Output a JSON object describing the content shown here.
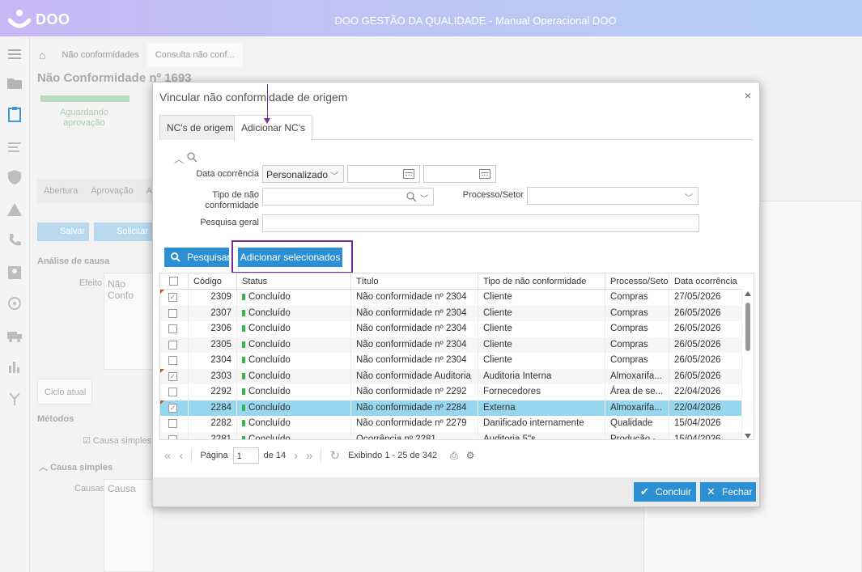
{
  "app": {
    "logo_text": "DOO",
    "window_title": "DOO GESTÃO DA QUALIDADE - Manual Operacional DOO"
  },
  "background": {
    "breadcrumbs": [
      "Não conformidades",
      "Consulta não conf..."
    ],
    "page_title": "Não Conformidade nº 1693",
    "status_line1": "Aguardando",
    "status_line2": "aprovação",
    "subtabs": [
      "Abertura",
      "Aprovação",
      "A"
    ],
    "btn_save": "Salvar",
    "btn_request": "Solicitar",
    "section_cause": "Análise de causa",
    "label_effect": "Efeito",
    "effect_value": "Não Confo",
    "current_cycle": "Ciclo atual",
    "methods": "Métodos",
    "simple_cause_check": "Causa simples",
    "simple_cause_header": "Causa simples",
    "label_causes": "Causas",
    "causes_value": "Causa"
  },
  "modal": {
    "title": "Vincular não conformidade de origem",
    "close_icon": "×",
    "tabs": [
      "NC's de origem",
      "Adicionar NC's"
    ],
    "filters": {
      "date_label": "Data ocorrência",
      "date_mode": "Personalizado",
      "date_from": "",
      "date_to": "",
      "type_label_1": "Tipo de não",
      "type_label_2": "conformidade",
      "type_value": "",
      "process_label": "Processo/Setor",
      "process_value": "",
      "general_label": "Pesquisa geral",
      "general_value": ""
    },
    "btn_search": "Pesquisar",
    "btn_add_selected": "Adicionar selecionados",
    "columns": [
      "Código",
      "Status",
      "Título",
      "Tipo de não conformidade",
      "Processo/Setor",
      "Data ocorrência"
    ],
    "rows": [
      {
        "checked": true,
        "flag": true,
        "code": "2309",
        "status": "Concluído",
        "title": "Não conformidade nº 2304",
        "type": "Cliente",
        "process": "Compras",
        "date": "27/05/2026"
      },
      {
        "checked": false,
        "flag": false,
        "code": "2307",
        "status": "Concluído",
        "title": "Não conformidade nº 2304",
        "type": "Cliente",
        "process": "Compras",
        "date": "26/05/2026"
      },
      {
        "checked": false,
        "flag": false,
        "code": "2306",
        "status": "Concluído",
        "title": "Não conformidade nº 2304",
        "type": "Cliente",
        "process": "Compras",
        "date": "26/05/2026"
      },
      {
        "checked": false,
        "flag": false,
        "code": "2305",
        "status": "Concluído",
        "title": "Não conformidade nº 2304",
        "type": "Cliente",
        "process": "Compras",
        "date": "26/05/2026"
      },
      {
        "checked": false,
        "flag": false,
        "code": "2304",
        "status": "Concluído",
        "title": "Não conformidade nº 2304",
        "type": "Cliente",
        "process": "Compras",
        "date": "26/05/2026"
      },
      {
        "checked": true,
        "flag": true,
        "code": "2303",
        "status": "Concluído",
        "title": "Não conformidade Auditoria",
        "type": "Auditoria Interna",
        "process": "Almoxarifa...",
        "date": "26/05/2026"
      },
      {
        "checked": false,
        "flag": false,
        "code": "2292",
        "status": "Concluído",
        "title": "Não conformidade nº 2292",
        "type": "Fornecedores",
        "process": "Área de se...",
        "date": "22/04/2026"
      },
      {
        "checked": true,
        "flag": true,
        "code": "2284",
        "status": "Concluído",
        "title": "Não conformidade nº 2284",
        "type": "Externa",
        "process": "Almoxarifa...",
        "date": "22/04/2026",
        "selected": true
      },
      {
        "checked": false,
        "flag": false,
        "code": "2282",
        "status": "Concluído",
        "title": "Não conformidade nº 2279",
        "type": "Danificado internamente",
        "process": "Qualidade",
        "date": "15/04/2026"
      },
      {
        "checked": false,
        "flag": false,
        "code": "2281",
        "status": "Concluído",
        "title": "Ocorrência nº 2281",
        "type": "Auditoria 5\"s",
        "process": "Produção -",
        "date": "15/04/2026"
      }
    ],
    "pager": {
      "page_label": "Página",
      "page_value": "1",
      "of_label": "de 14",
      "showing": "Exibindo 1 - 25 de 342"
    },
    "btn_conclude": "Concluir",
    "btn_close": "Fechar"
  },
  "colors": {
    "accent": "#2d8fd3",
    "selected_row": "#96d7ef",
    "status_ok": "#31b94a",
    "annotation": "#7a2c9a"
  }
}
